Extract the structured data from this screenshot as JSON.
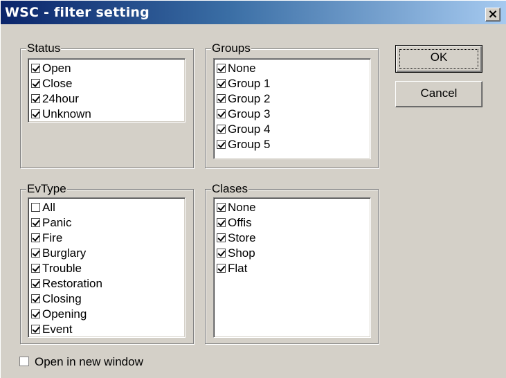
{
  "window": {
    "title": "WSC - filter setting",
    "close_glyph": "×"
  },
  "status": {
    "title": "Status",
    "items": [
      {
        "label": "Open",
        "checked": true
      },
      {
        "label": "Close",
        "checked": true
      },
      {
        "label": "24hour",
        "checked": true
      },
      {
        "label": "Unknown",
        "checked": true
      }
    ]
  },
  "groups": {
    "title": "Groups",
    "items": [
      {
        "label": "None",
        "checked": true
      },
      {
        "label": "Group 1",
        "checked": true
      },
      {
        "label": "Group 2",
        "checked": true
      },
      {
        "label": "Group 3",
        "checked": true
      },
      {
        "label": "Group 4",
        "checked": true
      },
      {
        "label": "Group 5",
        "checked": true
      }
    ]
  },
  "evtype": {
    "title": "EvType",
    "items": [
      {
        "label": "All",
        "checked": false
      },
      {
        "label": "Panic",
        "checked": true
      },
      {
        "label": "Fire",
        "checked": true
      },
      {
        "label": "Burglary",
        "checked": true
      },
      {
        "label": "Trouble",
        "checked": true
      },
      {
        "label": "Restoration",
        "checked": true
      },
      {
        "label": "Closing",
        "checked": true
      },
      {
        "label": "Opening",
        "checked": true
      },
      {
        "label": "Event",
        "checked": true
      }
    ]
  },
  "clases": {
    "title": "Clases",
    "items": [
      {
        "label": "None",
        "checked": true
      },
      {
        "label": "Offis",
        "checked": true
      },
      {
        "label": "Store",
        "checked": true
      },
      {
        "label": "Shop",
        "checked": true
      },
      {
        "label": "Flat",
        "checked": true
      }
    ]
  },
  "buttons": {
    "ok": "OK",
    "cancel": "Cancel"
  },
  "open_in_new_window": {
    "label": "Open in new window",
    "checked": false
  }
}
